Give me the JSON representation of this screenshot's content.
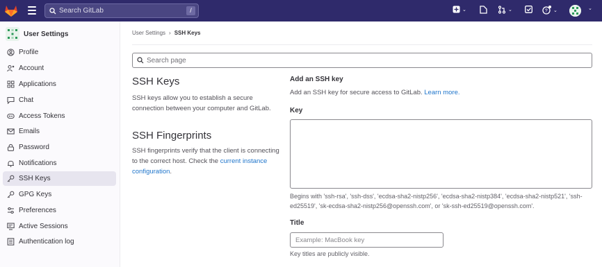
{
  "topbar": {
    "search_placeholder": "Search GitLab",
    "search_shortcut": "/"
  },
  "sidebar": {
    "title": "User Settings",
    "items": [
      {
        "label": "Profile",
        "icon": "profile-icon"
      },
      {
        "label": "Account",
        "icon": "account-icon"
      },
      {
        "label": "Applications",
        "icon": "applications-icon"
      },
      {
        "label": "Chat",
        "icon": "chat-icon"
      },
      {
        "label": "Access Tokens",
        "icon": "token-icon"
      },
      {
        "label": "Emails",
        "icon": "mail-icon"
      },
      {
        "label": "Password",
        "icon": "lock-icon"
      },
      {
        "label": "Notifications",
        "icon": "bell-icon"
      },
      {
        "label": "SSH Keys",
        "icon": "key-icon",
        "active": true
      },
      {
        "label": "GPG Keys",
        "icon": "key-icon"
      },
      {
        "label": "Preferences",
        "icon": "preferences-icon"
      },
      {
        "label": "Active Sessions",
        "icon": "monitor-icon"
      },
      {
        "label": "Authentication log",
        "icon": "log-icon"
      }
    ]
  },
  "breadcrumb": {
    "parent": "User Settings",
    "current": "SSH Keys"
  },
  "page_search_placeholder": "Search page",
  "ssh_keys": {
    "heading": "SSH Keys",
    "description": "SSH keys allow you to establish a secure connection between your computer and GitLab."
  },
  "fingerprints": {
    "heading": "SSH Fingerprints",
    "description": "SSH fingerprints verify that the client is connecting to the correct host. Check the",
    "link": "current instance configuration",
    "suffix": "."
  },
  "add_key": {
    "title": "Add an SSH key",
    "description": "Add an SSH key for secure access to GitLab.",
    "learn_more": "Learn more.",
    "key_label": "Key",
    "key_help": "Begins with 'ssh-rsa', 'ssh-dss', 'ecdsa-sha2-nistp256', 'ecdsa-sha2-nistp384', 'ecdsa-sha2-nistp521', 'ssh-ed25519', 'sk-ecdsa-sha2-nistp256@openssh.com', or 'sk-ssh-ed25519@openssh.com'.",
    "title_label": "Title",
    "title_placeholder": "Example: MacBook key",
    "title_help": "Key titles are publicly visible."
  },
  "colors": {
    "topbar": "#2f2a6b",
    "link": "#1f75cb",
    "active_item": "#e7e5ef"
  }
}
